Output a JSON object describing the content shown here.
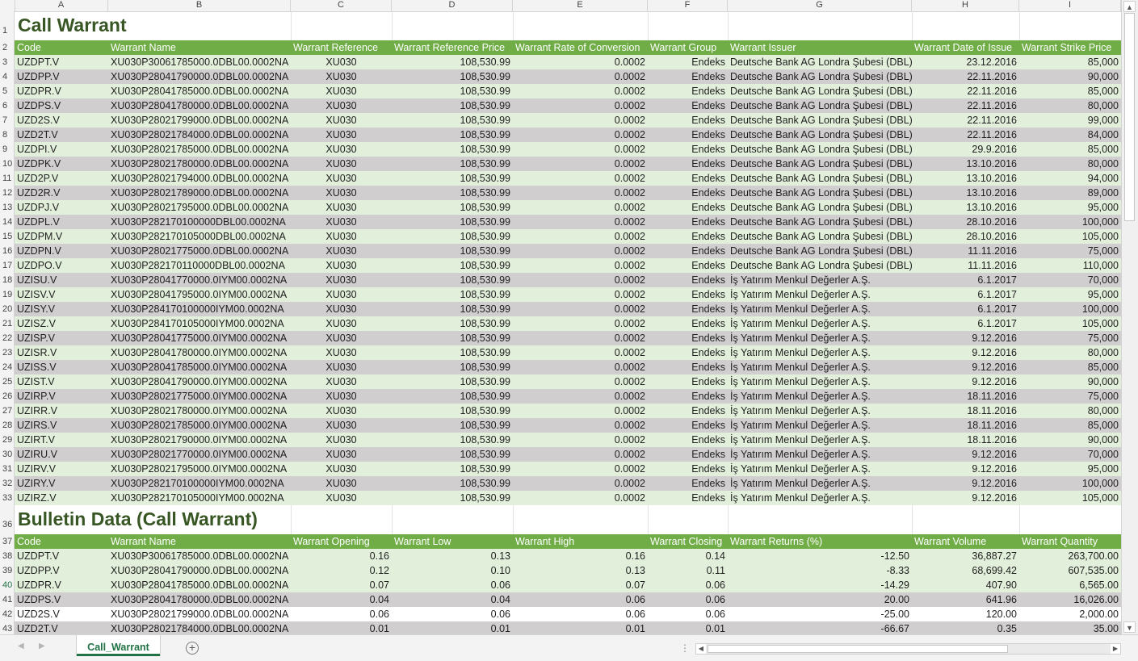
{
  "column_letters": [
    "A",
    "B",
    "C",
    "D",
    "E",
    "F",
    "G",
    "H",
    "I"
  ],
  "section1": {
    "title": "Call Warrant",
    "headers": [
      "Code",
      "Warrant Name",
      "Warrant Reference",
      "Warrant Reference Price",
      "Warrant Rate of Conversion",
      "Warrant Group",
      "Warrant Issuer",
      "Warrant Date of Issue",
      "Warrant Strike Price"
    ],
    "rows": [
      [
        "UZDPT.V",
        "XU030P30061785000.0DBL00.0002NA",
        "XU030",
        "108,530.99",
        "0.0002",
        "Endeks",
        "Deutsche Bank AG Londra Şubesi (DBL)",
        "23.12.2016",
        "85,000"
      ],
      [
        "UZDPP.V",
        "XU030P28041790000.0DBL00.0002NA",
        "XU030",
        "108,530.99",
        "0.0002",
        "Endeks",
        "Deutsche Bank AG Londra Şubesi (DBL)",
        "22.11.2016",
        "90,000"
      ],
      [
        "UZDPR.V",
        "XU030P28041785000.0DBL00.0002NA",
        "XU030",
        "108,530.99",
        "0.0002",
        "Endeks",
        "Deutsche Bank AG Londra Şubesi (DBL)",
        "22.11.2016",
        "85,000"
      ],
      [
        "UZDPS.V",
        "XU030P28041780000.0DBL00.0002NA",
        "XU030",
        "108,530.99",
        "0.0002",
        "Endeks",
        "Deutsche Bank AG Londra Şubesi (DBL)",
        "22.11.2016",
        "80,000"
      ],
      [
        "UZD2S.V",
        "XU030P28021799000.0DBL00.0002NA",
        "XU030",
        "108,530.99",
        "0.0002",
        "Endeks",
        "Deutsche Bank AG Londra Şubesi (DBL)",
        "22.11.2016",
        "99,000"
      ],
      [
        "UZD2T.V",
        "XU030P28021784000.0DBL00.0002NA",
        "XU030",
        "108,530.99",
        "0.0002",
        "Endeks",
        "Deutsche Bank AG Londra Şubesi (DBL)",
        "22.11.2016",
        "84,000"
      ],
      [
        "UZDPI.V",
        "XU030P28021785000.0DBL00.0002NA",
        "XU030",
        "108,530.99",
        "0.0002",
        "Endeks",
        "Deutsche Bank AG Londra Şubesi (DBL)",
        "29.9.2016",
        "85,000"
      ],
      [
        "UZDPK.V",
        "XU030P28021780000.0DBL00.0002NA",
        "XU030",
        "108,530.99",
        "0.0002",
        "Endeks",
        "Deutsche Bank AG Londra Şubesi (DBL)",
        "13.10.2016",
        "80,000"
      ],
      [
        "UZD2P.V",
        "XU030P28021794000.0DBL00.0002NA",
        "XU030",
        "108,530.99",
        "0.0002",
        "Endeks",
        "Deutsche Bank AG Londra Şubesi (DBL)",
        "13.10.2016",
        "94,000"
      ],
      [
        "UZD2R.V",
        "XU030P28021789000.0DBL00.0002NA",
        "XU030",
        "108,530.99",
        "0.0002",
        "Endeks",
        "Deutsche Bank AG Londra Şubesi (DBL)",
        "13.10.2016",
        "89,000"
      ],
      [
        "UZDPJ.V",
        "XU030P28021795000.0DBL00.0002NA",
        "XU030",
        "108,530.99",
        "0.0002",
        "Endeks",
        "Deutsche Bank AG Londra Şubesi (DBL)",
        "13.10.2016",
        "95,000"
      ],
      [
        "UZDPL.V",
        "XU030P282170100000DBL00.0002NA",
        "XU030",
        "108,530.99",
        "0.0002",
        "Endeks",
        "Deutsche Bank AG Londra Şubesi (DBL)",
        "28.10.2016",
        "100,000"
      ],
      [
        "UZDPM.V",
        "XU030P282170105000DBL00.0002NA",
        "XU030",
        "108,530.99",
        "0.0002",
        "Endeks",
        "Deutsche Bank AG Londra Şubesi (DBL)",
        "28.10.2016",
        "105,000"
      ],
      [
        "UZDPN.V",
        "XU030P28021775000.0DBL00.0002NA",
        "XU030",
        "108,530.99",
        "0.0002",
        "Endeks",
        "Deutsche Bank AG Londra Şubesi (DBL)",
        "11.11.2016",
        "75,000"
      ],
      [
        "UZDPO.V",
        "XU030P282170110000DBL00.0002NA",
        "XU030",
        "108,530.99",
        "0.0002",
        "Endeks",
        "Deutsche Bank AG Londra Şubesi (DBL)",
        "11.11.2016",
        "110,000"
      ],
      [
        "UZISU.V",
        "XU030P28041770000.0IYM00.0002NA",
        "XU030",
        "108,530.99",
        "0.0002",
        "Endeks",
        "İş Yatırım Menkul Değerler A.Ş.",
        "6.1.2017",
        "70,000"
      ],
      [
        "UZISV.V",
        "XU030P28041795000.0IYM00.0002NA",
        "XU030",
        "108,530.99",
        "0.0002",
        "Endeks",
        "İş Yatırım Menkul Değerler A.Ş.",
        "6.1.2017",
        "95,000"
      ],
      [
        "UZISY.V",
        "XU030P284170100000IYM00.0002NA",
        "XU030",
        "108,530.99",
        "0.0002",
        "Endeks",
        "İş Yatırım Menkul Değerler A.Ş.",
        "6.1.2017",
        "100,000"
      ],
      [
        "UZISZ.V",
        "XU030P284170105000IYM00.0002NA",
        "XU030",
        "108,530.99",
        "0.0002",
        "Endeks",
        "İş Yatırım Menkul Değerler A.Ş.",
        "6.1.2017",
        "105,000"
      ],
      [
        "UZISP.V",
        "XU030P28041775000.0IYM00.0002NA",
        "XU030",
        "108,530.99",
        "0.0002",
        "Endeks",
        "İş Yatırım Menkul Değerler A.Ş.",
        "9.12.2016",
        "75,000"
      ],
      [
        "UZISR.V",
        "XU030P28041780000.0IYM00.0002NA",
        "XU030",
        "108,530.99",
        "0.0002",
        "Endeks",
        "İş Yatırım Menkul Değerler A.Ş.",
        "9.12.2016",
        "80,000"
      ],
      [
        "UZISS.V",
        "XU030P28041785000.0IYM00.0002NA",
        "XU030",
        "108,530.99",
        "0.0002",
        "Endeks",
        "İş Yatırım Menkul Değerler A.Ş.",
        "9.12.2016",
        "85,000"
      ],
      [
        "UZIST.V",
        "XU030P28041790000.0IYM00.0002NA",
        "XU030",
        "108,530.99",
        "0.0002",
        "Endeks",
        "İş Yatırım Menkul Değerler A.Ş.",
        "9.12.2016",
        "90,000"
      ],
      [
        "UZIRP.V",
        "XU030P28021775000.0IYM00.0002NA",
        "XU030",
        "108,530.99",
        "0.0002",
        "Endeks",
        "İş Yatırım Menkul Değerler A.Ş.",
        "18.11.2016",
        "75,000"
      ],
      [
        "UZIRR.V",
        "XU030P28021780000.0IYM00.0002NA",
        "XU030",
        "108,530.99",
        "0.0002",
        "Endeks",
        "İş Yatırım Menkul Değerler A.Ş.",
        "18.11.2016",
        "80,000"
      ],
      [
        "UZIRS.V",
        "XU030P28021785000.0IYM00.0002NA",
        "XU030",
        "108,530.99",
        "0.0002",
        "Endeks",
        "İş Yatırım Menkul Değerler A.Ş.",
        "18.11.2016",
        "85,000"
      ],
      [
        "UZIRT.V",
        "XU030P28021790000.0IYM00.0002NA",
        "XU030",
        "108,530.99",
        "0.0002",
        "Endeks",
        "İş Yatırım Menkul Değerler A.Ş.",
        "18.11.2016",
        "90,000"
      ],
      [
        "UZIRU.V",
        "XU030P28021770000.0IYM00.0002NA",
        "XU030",
        "108,530.99",
        "0.0002",
        "Endeks",
        "İş Yatırım Menkul Değerler A.Ş.",
        "9.12.2016",
        "70,000"
      ],
      [
        "UZIRV.V",
        "XU030P28021795000.0IYM00.0002NA",
        "XU030",
        "108,530.99",
        "0.0002",
        "Endeks",
        "İş Yatırım Menkul Değerler A.Ş.",
        "9.12.2016",
        "95,000"
      ],
      [
        "UZIRY.V",
        "XU030P282170100000IYM00.0002NA",
        "XU030",
        "108,530.99",
        "0.0002",
        "Endeks",
        "İş Yatırım Menkul Değerler A.Ş.",
        "9.12.2016",
        "100,000"
      ],
      [
        "UZIRZ.V",
        "XU030P282170105000IYM00.0002NA",
        "XU030",
        "108,530.99",
        "0.0002",
        "Endeks",
        "İş Yatırım Menkul Değerler A.Ş.",
        "9.12.2016",
        "105,000"
      ]
    ]
  },
  "section2": {
    "title": "Bulletin Data (Call Warrant)",
    "headers": [
      "Code",
      "Warrant Name",
      "Warrant Opening",
      "Warrant Low",
      "Warrant High",
      "Warrant Closing",
      "Warrant Returns (%)",
      "Warrant Volume",
      "Warrant Quantity"
    ],
    "rows": [
      [
        "UZDPT.V",
        "XU030P30061785000.0DBL00.0002NA",
        "0.16",
        "0.13",
        "0.16",
        "0.14",
        "-12.50",
        "36,887.27",
        "263,700.00"
      ],
      [
        "UZDPP.V",
        "XU030P28041790000.0DBL00.0002NA",
        "0.12",
        "0.10",
        "0.13",
        "0.11",
        "-8.33",
        "68,699.42",
        "607,535.00"
      ],
      [
        "UZDPR.V",
        "XU030P28041785000.0DBL00.0002NA",
        "0.07",
        "0.06",
        "0.07",
        "0.06",
        "-14.29",
        "407.90",
        "6,565.00"
      ],
      [
        "UZDPS.V",
        "XU030P28041780000.0DBL00.0002NA",
        "0.04",
        "0.04",
        "0.06",
        "0.06",
        "20.00",
        "641.96",
        "16,026.00"
      ],
      [
        "UZD2S.V",
        "XU030P28021799000.0DBL00.0002NA",
        "0.06",
        "0.06",
        "0.06",
        "0.06",
        "-25.00",
        "120.00",
        "2,000.00"
      ],
      [
        "UZD2T.V",
        "XU030P28021784000.0DBL00.0002NA",
        "0.01",
        "0.01",
        "0.01",
        "0.01",
        "-66.67",
        "0.35",
        "35.00"
      ]
    ]
  },
  "sheet_tab": {
    "label": "Call_Warrant"
  },
  "colors": {
    "header_green": "#70ad47",
    "band_light": "#e2efda",
    "band_gray": "#d0cece",
    "title_green": "#375623",
    "excel_green": "#217346"
  }
}
